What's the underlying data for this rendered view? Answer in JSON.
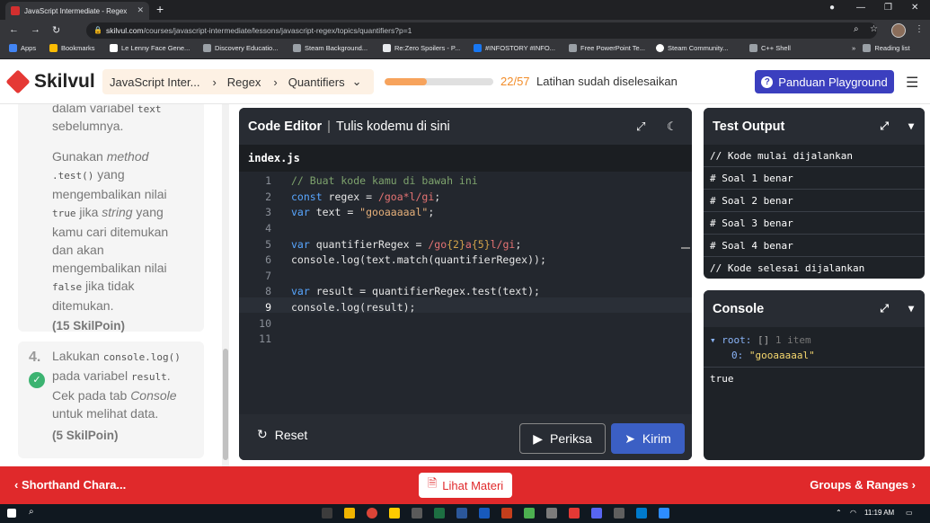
{
  "browser": {
    "tab_title": "JavaScript Intermediate - Regex",
    "url_host": "skilvul.com",
    "url_path": "/courses/javascript-intermediate/lessons/javascript-regex/topics/quantifiers?p=1",
    "bookmarks": [
      {
        "label": "Apps",
        "color": "#4285f4"
      },
      {
        "label": "Bookmarks",
        "color": "#fbbc04"
      },
      {
        "label": "Le Lenny Face Gene...",
        "color": "#ffffff"
      },
      {
        "label": "Discovery Educatio...",
        "color": "#9aa0a6"
      },
      {
        "label": "Steam Background...",
        "color": "#9aa0a6"
      },
      {
        "label": "Re:Zero Spoilers - P...",
        "color": "#e8eaed"
      },
      {
        "label": "#INFOSTORY #INFO...",
        "color": "#1877f2"
      },
      {
        "label": "Free PowerPoint Te...",
        "color": "#9aa0a6"
      },
      {
        "label": "Steam Community...",
        "color": "#ffffff"
      },
      {
        "label": "C++ Shell",
        "color": "#9aa0a6"
      }
    ],
    "reading_list": "Reading list"
  },
  "header": {
    "logo_text": "Skilvul",
    "breadcrumbs": [
      "JavaScript Inter...",
      "Regex",
      "Quantifiers"
    ],
    "progress_count": "22/57",
    "progress_fraction": 0.386,
    "progress_text": "Latihan sudah diselesaikan",
    "guide_button": "Panduan Playground"
  },
  "lesson": {
    "step3_top": [
      "dalam variabel",
      "text",
      "sebelumnya."
    ],
    "step3_body": {
      "l1a": "Gunakan",
      "l1b": "method",
      "l2code": ".test()",
      "l2b": "yang",
      "l3": "mengembalikan nilai",
      "l4code": "true",
      "l4b": "jika",
      "l4c": "string",
      "l4d": "yang",
      "l5": "kamu cari ditemukan",
      "l6": "dan akan",
      "l7": "mengembalikan nilai",
      "l8code": "false",
      "l8b": "jika tidak",
      "l9": "ditemukan."
    },
    "step3_points": "(15 SkilPoin)",
    "step4_num": "4.",
    "step4": {
      "a": "Lakukan",
      "acode": "console.log()",
      "b": "pada variabel",
      "bcode": "result",
      "bdot": ".",
      "c1": "Cek pada tab",
      "c2": "Console",
      "d": "untuk melihat data."
    },
    "step4_points": "(5 SkilPoin)"
  },
  "editor": {
    "title": "Code Editor",
    "subtitle": "Tulis kodemu di sini",
    "filename": "index.js",
    "line_numbers": [
      "1",
      "2",
      "3",
      "4",
      "5",
      "6",
      "7",
      "8",
      "9",
      "10",
      "11"
    ],
    "lines": {
      "l1": "// Buat kode kamu di bawah ini",
      "l2_kw": "const",
      "l2_a": " regex = ",
      "l2_re": "/goa*l/gi",
      "l2_end": ";",
      "l3_kw": "var",
      "l3_a": " text = ",
      "l3_str": "\"gooaaaaal\"",
      "l3_end": ";",
      "l5_kw": "var",
      "l5_a": " quantifierRegex = ",
      "l5_re1": "/go",
      "l5_q1": "{2}",
      "l5_re2": "a",
      "l5_q2": "{5}",
      "l5_re3": "l/gi",
      "l5_end": ";",
      "l6": "console.log(text.match(quantifierRegex));",
      "l8_kw": "var",
      "l8_a": " result = quantifierRegex.test(text);",
      "l9": "console.log(result);"
    },
    "reset_label": "Reset",
    "check_label": "Periksa",
    "submit_label": "Kirim"
  },
  "test_output": {
    "title": "Test Output",
    "rows": [
      "// Kode mulai dijalankan",
      "# Soal 1 benar",
      "# Soal 2 benar",
      "# Soal 3 benar",
      "# Soal 4 benar",
      "// Kode selesai dijalankan"
    ]
  },
  "console": {
    "title": "Console",
    "root_key": "root:",
    "root_brackets": "[]",
    "root_meta": "1 item",
    "item_key": "0:",
    "item_val": "\"gooaaaaal\"",
    "result": "true"
  },
  "bottom_nav": {
    "prev": "Shorthand Chara...",
    "materi": "Lihat Materi",
    "next": "Groups & Ranges"
  },
  "taskbar": {
    "time": "11:19 AM"
  }
}
